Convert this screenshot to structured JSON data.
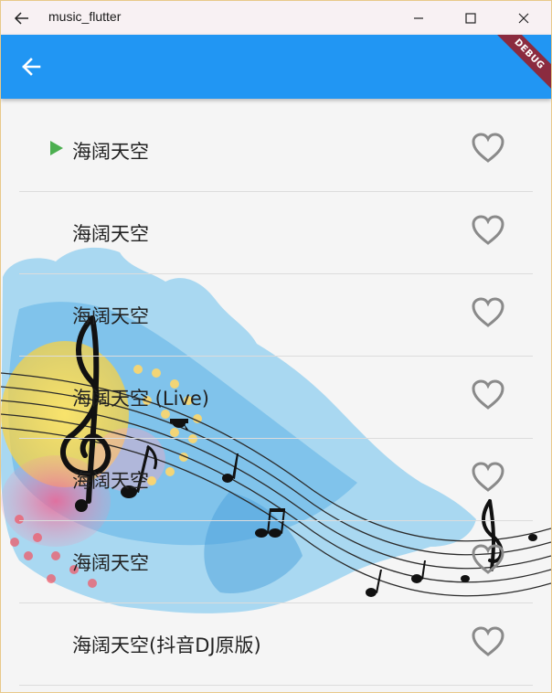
{
  "window": {
    "title": "music_flutter"
  },
  "appbar": {
    "color": "#2196f3",
    "back_icon": "arrow-back-icon",
    "debug_banner": "DEBUG"
  },
  "songs": [
    {
      "title": "海阔天空",
      "playing": true
    },
    {
      "title": "海阔天空",
      "playing": false
    },
    {
      "title": "海阔天空",
      "playing": false
    },
    {
      "title": "海阔天空 (Live)",
      "playing": false
    },
    {
      "title": "海阔天空",
      "playing": false
    },
    {
      "title": "海阔天空",
      "playing": false
    },
    {
      "title": "海阔天空(抖音DJ原版)",
      "playing": false
    }
  ],
  "colors": {
    "play_indicator": "#4caf50",
    "heart_outline": "#8a8a8a"
  }
}
